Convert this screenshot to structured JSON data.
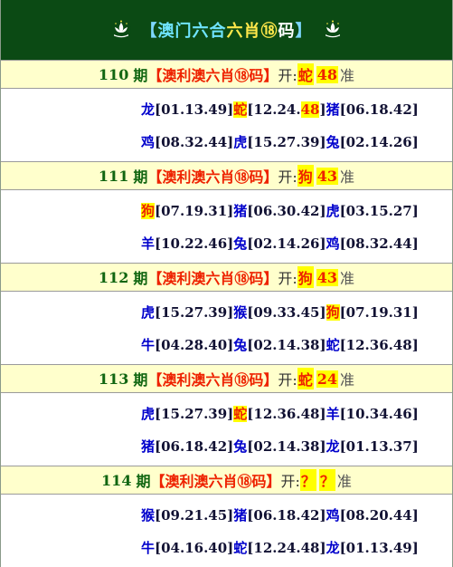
{
  "header": {
    "bracket_left": "【",
    "title_part1": "澳门",
    "title_part2": "六合",
    "title_part3": "六肖",
    "title_part4": "⑱",
    "title_part5": "码",
    "bracket_right": "】",
    "icon": "lotus-emblem-icon"
  },
  "issues": [
    {
      "number": "110",
      "period": "期",
      "title": "【澳利澳六肖⑱码】",
      "open_label": "开:",
      "open_zodiac": "蛇",
      "open_number": "48",
      "accuracy": "准",
      "rows": [
        [
          {
            "zodiac": "龙",
            "nums": "[01.13.49]",
            "hit": false
          },
          {
            "zodiac": "蛇",
            "nums_before": "[12.24.",
            "hit_num": "48",
            "nums_after": "]",
            "hit": true
          },
          {
            "zodiac": "猪",
            "nums": "[06.18.42]",
            "hit": false
          }
        ],
        [
          {
            "zodiac": "鸡",
            "nums": "[08.32.44]",
            "hit": false
          },
          {
            "zodiac": "虎",
            "nums": "[15.27.39]",
            "hit": false
          },
          {
            "zodiac": "兔",
            "nums": "[02.14.26]",
            "hit": false
          }
        ]
      ]
    },
    {
      "number": "111",
      "period": "期",
      "title": "【澳利澳六肖⑱码】",
      "open_label": "开:",
      "open_zodiac": "狗",
      "open_number": "43",
      "accuracy": "准",
      "rows": [
        [
          {
            "zodiac": "狗",
            "nums": "[07.19.31]",
            "hit": true
          },
          {
            "zodiac": "猪",
            "nums": "[06.30.42]",
            "hit": false
          },
          {
            "zodiac": "虎",
            "nums": "[03.15.27]",
            "hit": false
          }
        ],
        [
          {
            "zodiac": "羊",
            "nums": "[10.22.46]",
            "hit": false
          },
          {
            "zodiac": "兔",
            "nums": "[02.14.26]",
            "hit": false
          },
          {
            "zodiac": "鸡",
            "nums": "[08.32.44]",
            "hit": false
          }
        ]
      ]
    },
    {
      "number": "112",
      "period": "期",
      "title": "【澳利澳六肖⑱码】",
      "open_label": "开:",
      "open_zodiac": "狗",
      "open_number": "43",
      "accuracy": "准",
      "rows": [
        [
          {
            "zodiac": "虎",
            "nums": "[15.27.39]",
            "hit": false
          },
          {
            "zodiac": "猴",
            "nums": "[09.33.45]",
            "hit": false
          },
          {
            "zodiac": "狗",
            "nums": "[07.19.31]",
            "hit": true
          }
        ],
        [
          {
            "zodiac": "牛",
            "nums": "[04.28.40]",
            "hit": false
          },
          {
            "zodiac": "兔",
            "nums": "[02.14.38]",
            "hit": false
          },
          {
            "zodiac": "蛇",
            "nums": "[12.36.48]",
            "hit": false
          }
        ]
      ]
    },
    {
      "number": "113",
      "period": "期",
      "title": "【澳利澳六肖⑱码】",
      "open_label": "开:",
      "open_zodiac": "蛇",
      "open_number": "24",
      "accuracy": "准",
      "rows": [
        [
          {
            "zodiac": "虎",
            "nums": "[15.27.39]",
            "hit": false
          },
          {
            "zodiac": "蛇",
            "nums": "[12.36.48]",
            "hit": true
          },
          {
            "zodiac": "羊",
            "nums": "[10.34.46]",
            "hit": false
          }
        ],
        [
          {
            "zodiac": "猪",
            "nums": "[06.18.42]",
            "hit": false
          },
          {
            "zodiac": "兔",
            "nums": "[02.14.38]",
            "hit": false
          },
          {
            "zodiac": "龙",
            "nums": "[01.13.37]",
            "hit": false
          }
        ]
      ]
    },
    {
      "number": "114",
      "period": "期",
      "title": "【澳利澳六肖⑱码】",
      "open_label": "开:",
      "open_zodiac": "？",
      "open_number": "？",
      "accuracy": "准",
      "rows": [
        [
          {
            "zodiac": "猴",
            "nums": "[09.21.45]",
            "hit": false
          },
          {
            "zodiac": "猪",
            "nums": "[06.18.42]",
            "hit": false
          },
          {
            "zodiac": "鸡",
            "nums": "[08.20.44]",
            "hit": false
          }
        ],
        [
          {
            "zodiac": "牛",
            "nums": "[04.16.40]",
            "hit": false
          },
          {
            "zodiac": "蛇",
            "nums": "[12.24.48]",
            "hit": false
          },
          {
            "zodiac": "龙",
            "nums": "[01.13.49]",
            "hit": false
          }
        ]
      ]
    }
  ],
  "colors": {
    "header_bg": "#0b4a14",
    "issue_bar_bg": "#ffffcc",
    "highlight_bg": "#ffff00",
    "red_text": "#ee2200",
    "green_text": "#116611",
    "blue_zodiac": "#0000cc"
  }
}
